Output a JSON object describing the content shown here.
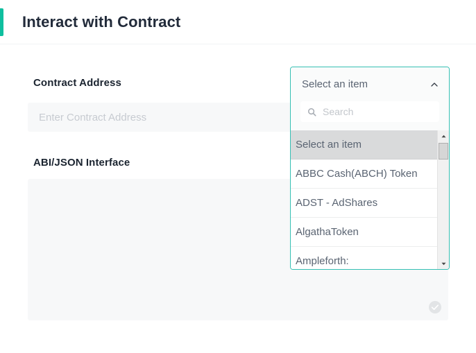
{
  "header": {
    "title": "Interact with Contract",
    "accent_color": "#0fbf9f"
  },
  "form": {
    "contract_address": {
      "label": "Contract Address",
      "placeholder": "Enter Contract Address",
      "value": ""
    },
    "abi_interface": {
      "label": "ABI/JSON Interface",
      "placeholder": "",
      "value": "",
      "status_icon": "check-circle-icon"
    }
  },
  "dropdown": {
    "border_color": "#35bfb3",
    "selected_label": "Select an item",
    "toggle_icon": "chevron-up-icon",
    "search": {
      "placeholder": "Search",
      "value": "",
      "icon": "search-icon"
    },
    "items": [
      {
        "label": "Select an item",
        "selected": true
      },
      {
        "label": "ABBC Cash(ABCH) Token",
        "selected": false
      },
      {
        "label": "ADST - AdShares",
        "selected": false
      },
      {
        "label": "AlgathaToken",
        "selected": false
      },
      {
        "label": "Ampleforth:",
        "selected": false
      }
    ],
    "scrollbar": {
      "up_arrow_icon": "caret-up-icon",
      "down_arrow_icon": "caret-down-icon",
      "thumb": "scroll-thumb"
    }
  }
}
